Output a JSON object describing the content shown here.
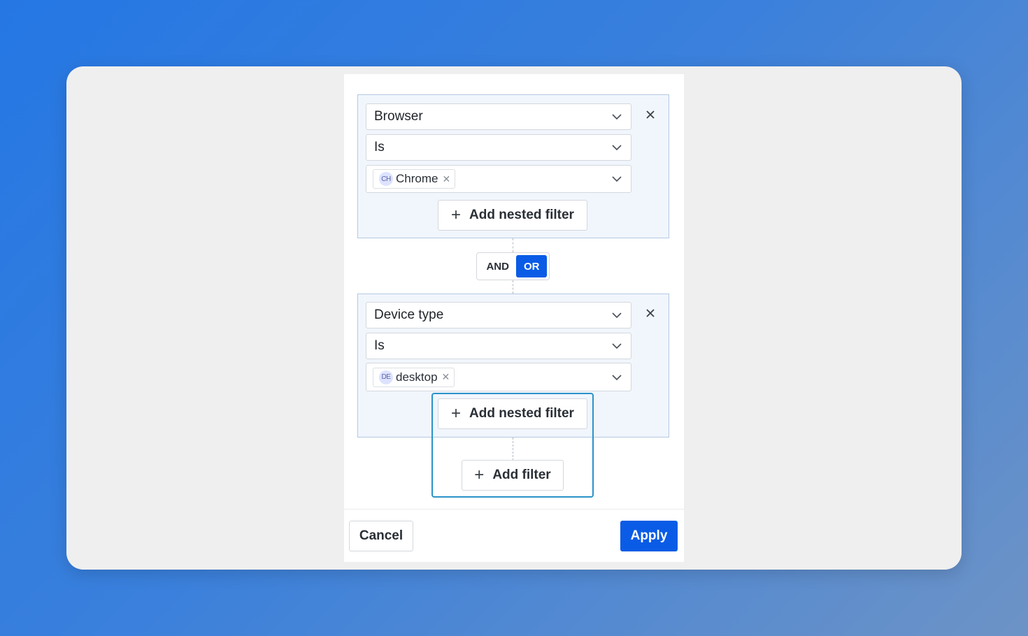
{
  "filters": [
    {
      "field": "Browser",
      "operator": "Is",
      "value_chip": {
        "abbr": "CH",
        "label": "Chrome"
      },
      "add_nested_label": "Add nested filter"
    },
    {
      "field": "Device type",
      "operator": "Is",
      "value_chip": {
        "abbr": "DE",
        "label": "desktop"
      },
      "add_nested_label": "Add nested filter"
    }
  ],
  "logic_toggle": {
    "and_label": "AND",
    "or_label": "OR",
    "selected": "OR"
  },
  "add_filter_label": "Add filter",
  "footer": {
    "cancel_label": "Cancel",
    "apply_label": "Apply"
  },
  "colors": {
    "primary": "#0a5ce6",
    "highlight": "#2b93c9",
    "group_bg": "#f1f6fd"
  },
  "icons": {
    "dropdown": "chevron-down-icon",
    "remove": "close-icon",
    "add": "plus-icon"
  }
}
